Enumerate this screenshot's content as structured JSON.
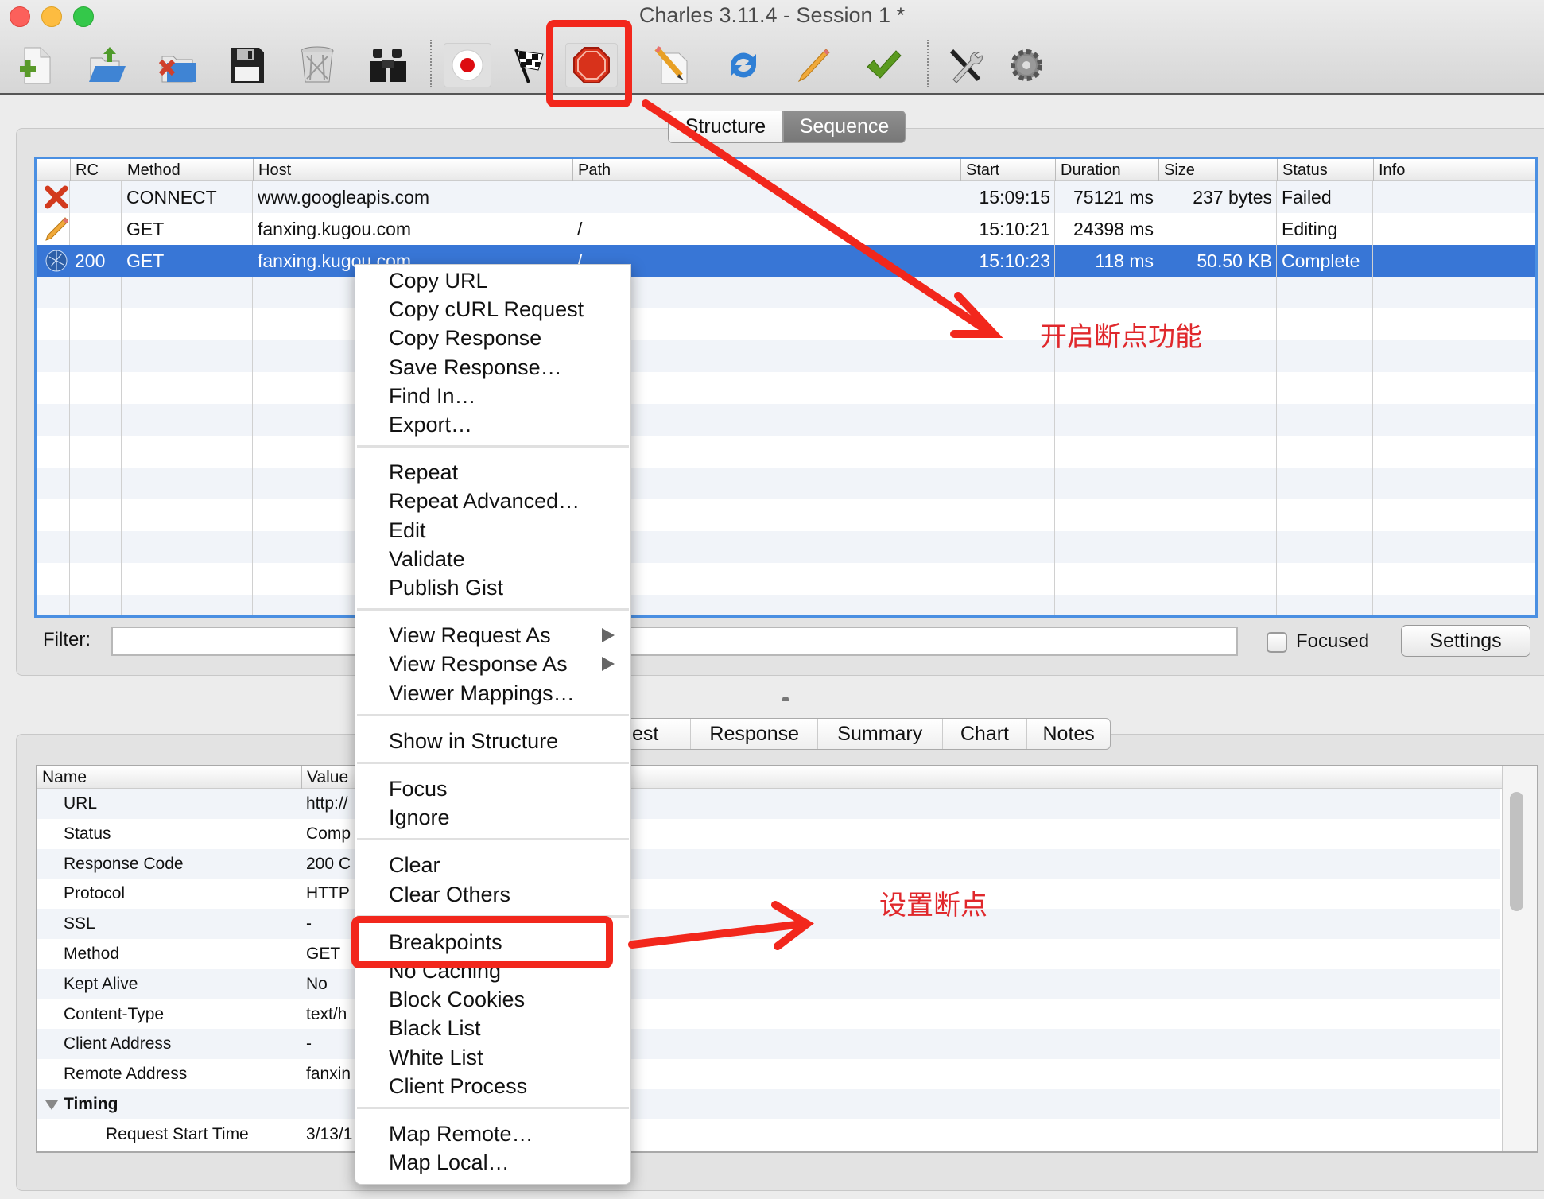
{
  "window": {
    "title": "Charles 3.11.4 - Session 1 *",
    "traffic_lights": {
      "close": "#fc605b",
      "minimize": "#fdbc40",
      "zoom": "#34c84a"
    }
  },
  "toolbar": {
    "items": [
      {
        "name": "new-session",
        "icon": "new-document-icon"
      },
      {
        "name": "open-session",
        "icon": "open-folder-icon"
      },
      {
        "name": "close-session",
        "icon": "close-folder-icon"
      },
      {
        "name": "save-session",
        "icon": "floppy-disk-icon"
      },
      {
        "name": "clear-session",
        "icon": "trash-icon"
      },
      {
        "name": "find",
        "icon": "binoculars-icon"
      },
      {
        "name": "start-recording",
        "icon": "record-icon"
      },
      {
        "name": "start-throttling",
        "icon": "checkered-flag-icon"
      },
      {
        "name": "enable-breakpoints",
        "icon": "stop-sign-icon"
      },
      {
        "name": "compose",
        "icon": "pencil-document-icon"
      },
      {
        "name": "repeat",
        "icon": "refresh-icon"
      },
      {
        "name": "edit",
        "icon": "pencil-icon"
      },
      {
        "name": "validate",
        "icon": "checkmark-icon"
      },
      {
        "name": "tools",
        "icon": "tools-icon"
      },
      {
        "name": "settings",
        "icon": "gear-icon"
      }
    ]
  },
  "view_tabs": {
    "structure": "Structure",
    "sequence": "Sequence",
    "active": "Sequence"
  },
  "sessions_table": {
    "columns": [
      "",
      "RC",
      "Method",
      "Host",
      "Path",
      "Start",
      "Duration",
      "Size",
      "Status",
      "Info"
    ],
    "rows": [
      {
        "icon": "failed-x-icon",
        "rc": "",
        "method": "CONNECT",
        "host": "www.googleapis.com",
        "path": "",
        "start": "15:09:15",
        "duration": "75121 ms",
        "size": "237 bytes",
        "status": "Failed",
        "info": ""
      },
      {
        "icon": "editing-pencil-icon",
        "rc": "",
        "method": "GET",
        "host": "fanxing.kugou.com",
        "path": "/",
        "start": "15:10:21",
        "duration": "24398 ms",
        "size": "",
        "status": "Editing",
        "info": ""
      },
      {
        "icon": "globe-icon",
        "rc": "200",
        "method": "GET",
        "host": "fanxing.kugou.com",
        "path": "/",
        "start": "15:10:23",
        "duration": "118 ms",
        "size": "50.50 KB",
        "status": "Complete",
        "info": "",
        "selected": true
      }
    ]
  },
  "filter": {
    "label": "Filter:",
    "value": "",
    "focused_label": "Focused",
    "focused_checked": false,
    "settings_label": "Settings"
  },
  "detail_tabs": [
    "Request",
    "Response",
    "Summary",
    "Chart",
    "Notes"
  ],
  "detail_tabs_visible": [
    "uest",
    "Response",
    "Summary",
    "Chart",
    "Notes"
  ],
  "overview": {
    "columns": [
      "Name",
      "Value"
    ],
    "rows": [
      {
        "name": "URL",
        "value": "http://"
      },
      {
        "name": "Status",
        "value": "Comp"
      },
      {
        "name": "Response Code",
        "value": "200 C"
      },
      {
        "name": "Protocol",
        "value": "HTTP"
      },
      {
        "name": "SSL",
        "value": "-"
      },
      {
        "name": "Method",
        "value": "GET"
      },
      {
        "name": "Kept Alive",
        "value": "No"
      },
      {
        "name": "Content-Type",
        "value": "text/h"
      },
      {
        "name": "Client Address",
        "value": "-"
      },
      {
        "name": "Remote Address",
        "value": "fanxin"
      },
      {
        "name": "Timing",
        "value": "",
        "group": true
      },
      {
        "name": "Request Start Time",
        "value": "3/13/1",
        "indent": true
      }
    ]
  },
  "context_menu": {
    "groups": [
      [
        "Copy URL",
        "Copy cURL Request",
        "Copy Response",
        "Save Response…",
        "Find In…",
        "Export…"
      ],
      [
        "Repeat",
        "Repeat Advanced…",
        "Edit",
        "Validate",
        "Publish Gist"
      ],
      [
        "View Request As",
        "View Response As",
        "Viewer Mappings…"
      ],
      [
        "Show in Structure"
      ],
      [
        "Focus",
        "Ignore"
      ],
      [
        "Clear",
        "Clear Others"
      ],
      [
        "Breakpoints",
        "No Caching",
        "Block Cookies",
        "Black List",
        "White List",
        "Client Process"
      ],
      [
        "Map Remote…",
        "Map Local…"
      ]
    ],
    "submenu_items": [
      "View Request As",
      "View Response As"
    ]
  },
  "annotations": {
    "enable_breakpoints": "开启断点功能",
    "set_breakpoint": "设置断点",
    "color": "#f2271c"
  }
}
